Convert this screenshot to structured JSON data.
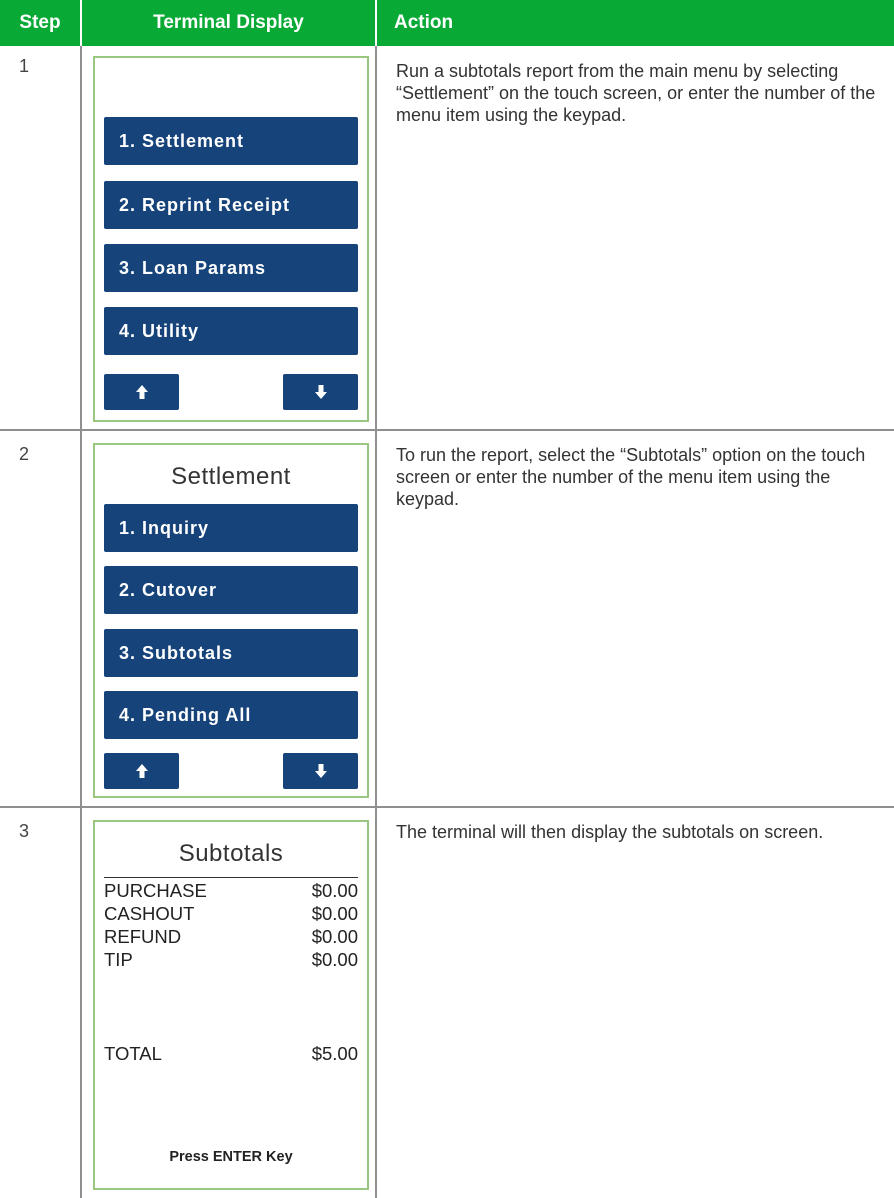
{
  "header": {
    "step": "Step",
    "terminal": "Terminal Display",
    "action": "Action"
  },
  "rows": [
    {
      "step": "1",
      "action": "Run a subtotals report from the main menu by selecting “Settlement” on the touch screen, or enter the number of the menu item using the keypad.",
      "screen": {
        "title": "",
        "items": [
          "1. Settlement",
          "2. Reprint Receipt",
          "3. Loan Params",
          "4. Utility"
        ],
        "up_icon": "arrow-up-icon",
        "down_icon": "arrow-down-icon"
      }
    },
    {
      "step": "2",
      "action": "To run the report, select the “Subtotals” option on the touch screen or enter the number of the menu item using the keypad.",
      "screen": {
        "title": "Settlement",
        "items": [
          "1. Inquiry",
          "2. Cutover",
          "3. Subtotals",
          "4. Pending All"
        ],
        "up_icon": "arrow-up-icon",
        "down_icon": "arrow-down-icon"
      }
    },
    {
      "step": "3",
      "action": "The terminal will then display the subtotals on screen.",
      "screen": {
        "title": "Subtotals",
        "lines": [
          {
            "label": "PURCHASE",
            "value": "$0.00"
          },
          {
            "label": "CASHOUT",
            "value": "$0.00"
          },
          {
            "label": "REFUND",
            "value": "$0.00"
          },
          {
            "label": "TIP",
            "value": "$0.00"
          }
        ],
        "total": {
          "label": "TOTAL",
          "value": "$5.00"
        },
        "footer": "Press ENTER Key"
      }
    }
  ],
  "colors": {
    "header_bg": "#08a935",
    "button_bg": "#16437a",
    "screen_border": "#9ac77f",
    "grid": "#8f8f8f"
  }
}
